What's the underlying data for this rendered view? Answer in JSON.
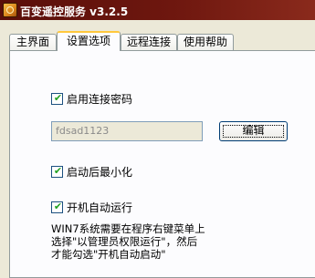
{
  "window": {
    "title": "百变遥控服务  v3.2.5"
  },
  "tabs": [
    {
      "label": "主界面"
    },
    {
      "label": "设置选项"
    },
    {
      "label": "远程连接"
    },
    {
      "label": "使用帮助"
    }
  ],
  "settings": {
    "enable_password": {
      "label": "启用连接密码",
      "checked": true
    },
    "password_value": "fdsad1123",
    "edit_button": "编辑",
    "minimize_on_start": {
      "label": "启动后最小化",
      "checked": true
    },
    "autostart": {
      "label": "开机自动运行",
      "checked": true
    },
    "note_lines": [
      "WIN7系统需要在程序右键菜单上",
      "选择\"以管理员权限运行\"，然后",
      "才能勾选\"开机自动启动\""
    ]
  }
}
